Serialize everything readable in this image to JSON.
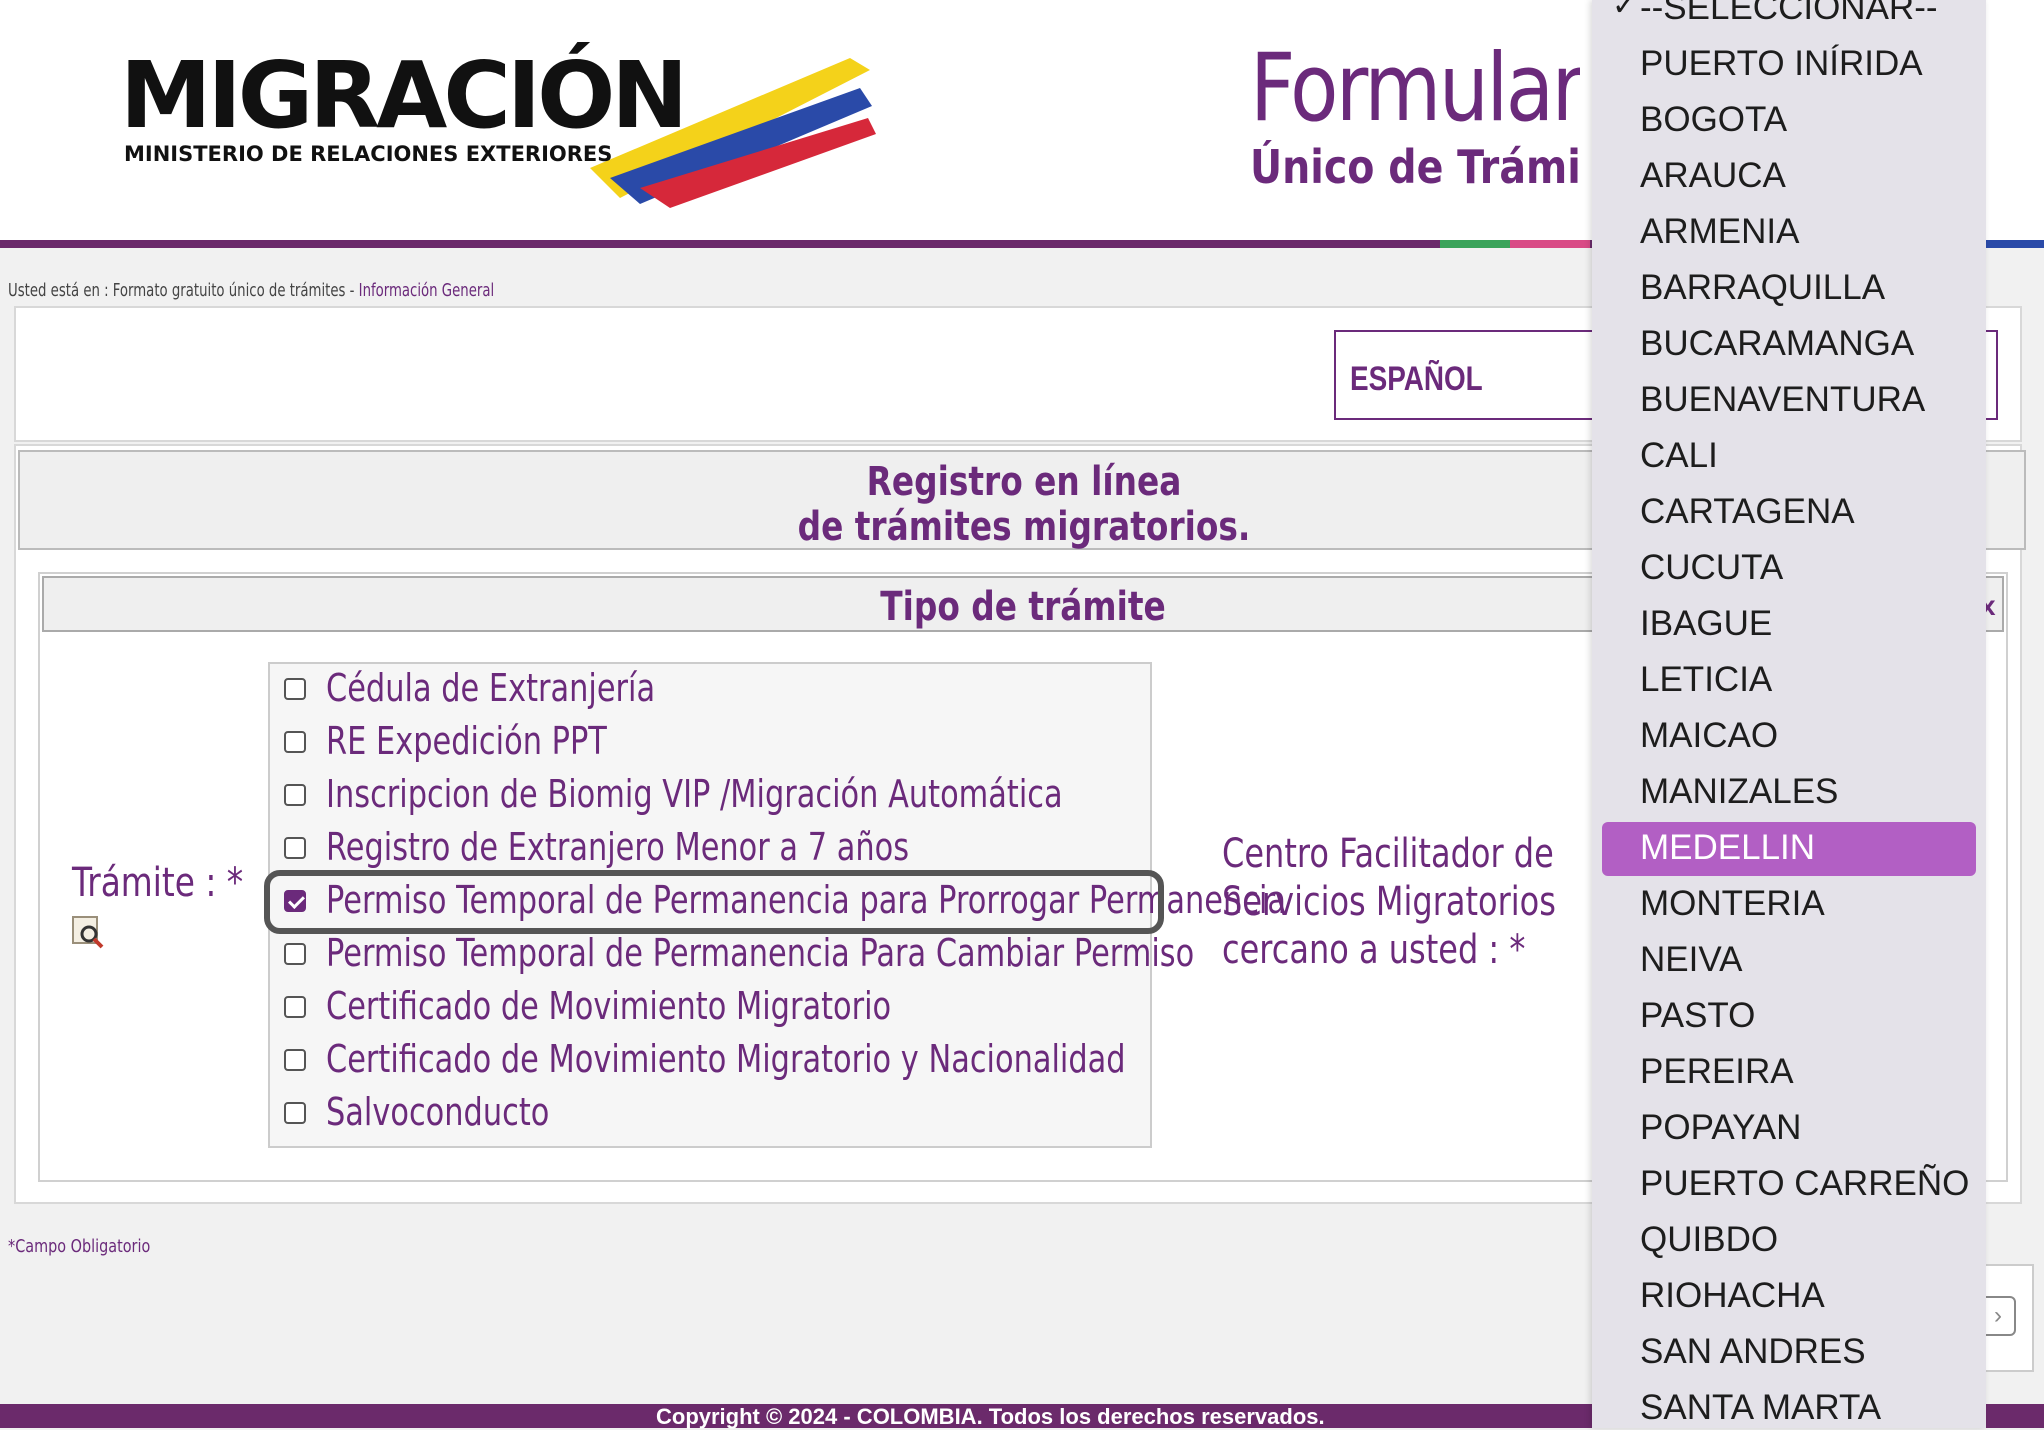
{
  "logo": {
    "word": "MIGRACIÓN",
    "subtitle": "MINISTERIO DE RELACIONES EXTERIORES"
  },
  "form_title": {
    "line1": "Formular",
    "line2": "Único de Trámi"
  },
  "breadcrumb": {
    "prefix": "Usted está en : Formato gratuito único de trámites - ",
    "link": "Información General"
  },
  "language": {
    "selected": "ESPAÑOL"
  },
  "registro": {
    "line1": "Registro en línea",
    "line2": "de trámites migratorios."
  },
  "tipo_tramite": {
    "title": "Tipo de trámite",
    "close": "x"
  },
  "tramite_label": "Trámite : *",
  "tramite_options": [
    {
      "label": "Cédula de Extranjería",
      "checked": false
    },
    {
      "label": "RE Expedición PPT",
      "checked": false
    },
    {
      "label": "Inscripcion de Biomig VIP /Migración Automática",
      "checked": false
    },
    {
      "label": "Registro de Extranjero Menor a 7 años",
      "checked": false
    },
    {
      "label": "Permiso Temporal de Permanencia para Prorrogar Permanencia",
      "checked": true
    },
    {
      "label": "Permiso Temporal de Permanencia Para Cambiar Permiso",
      "checked": false
    },
    {
      "label": "Certificado de Movimiento Migratorio",
      "checked": false
    },
    {
      "label": "Certificado de Movimiento Migratorio y Nacionalidad",
      "checked": false
    },
    {
      "label": "Salvoconducto",
      "checked": false
    }
  ],
  "centro_label": {
    "line1": "Centro Facilitador de",
    "line2": "Servicios Migratorios",
    "line3": "cercano a usted : *"
  },
  "campo_obligatorio": "*Campo Obligatorio",
  "footer": "Copyright © 2024 - COLOMBIA. Todos los derechos reservados.",
  "dropdown": {
    "check_mark": "✓",
    "selected_index": 15,
    "options": [
      "--SELECCIONAR--",
      "PUERTO INÍRIDA",
      "BOGOTA",
      "ARAUCA",
      "ARMENIA",
      "BARRAQUILLA",
      "BUCARAMANGA",
      "BUENAVENTURA",
      "CALI",
      "CARTAGENA",
      "CUCUTA",
      "IBAGUE",
      "LETICIA",
      "MAICAO",
      "MANIZALES",
      "MEDELLIN",
      "MONTERIA",
      "NEIVA",
      "PASTO",
      "PEREIRA",
      "POPAYAN",
      "PUERTO CARREÑO",
      "QUIBDO",
      "RIOHACHA",
      "SAN ANDRES",
      "SANTA MARTA"
    ]
  },
  "colors": {
    "brand_purple": "#6b2a7b",
    "highlight": "#b25fc4"
  }
}
